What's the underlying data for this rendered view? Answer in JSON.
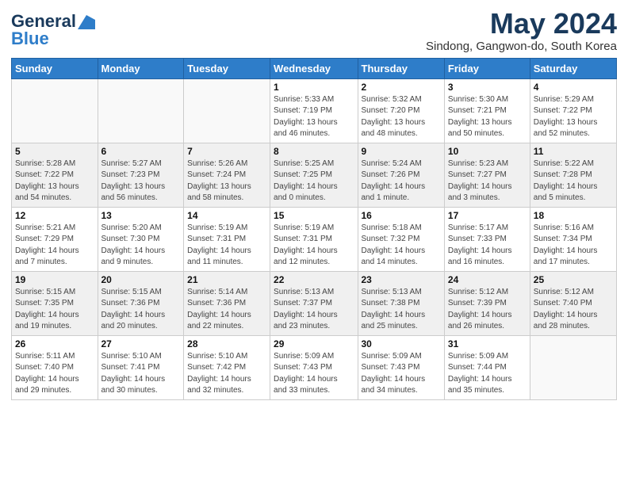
{
  "logo": {
    "line1": "General",
    "line2": "Blue",
    "tagline": ""
  },
  "title": "May 2024",
  "location": "Sindong, Gangwon-do, South Korea",
  "weekdays": [
    "Sunday",
    "Monday",
    "Tuesday",
    "Wednesday",
    "Thursday",
    "Friday",
    "Saturday"
  ],
  "weeks": [
    [
      {
        "day": "",
        "info": ""
      },
      {
        "day": "",
        "info": ""
      },
      {
        "day": "",
        "info": ""
      },
      {
        "day": "1",
        "info": "Sunrise: 5:33 AM\nSunset: 7:19 PM\nDaylight: 13 hours\nand 46 minutes."
      },
      {
        "day": "2",
        "info": "Sunrise: 5:32 AM\nSunset: 7:20 PM\nDaylight: 13 hours\nand 48 minutes."
      },
      {
        "day": "3",
        "info": "Sunrise: 5:30 AM\nSunset: 7:21 PM\nDaylight: 13 hours\nand 50 minutes."
      },
      {
        "day": "4",
        "info": "Sunrise: 5:29 AM\nSunset: 7:22 PM\nDaylight: 13 hours\nand 52 minutes."
      }
    ],
    [
      {
        "day": "5",
        "info": "Sunrise: 5:28 AM\nSunset: 7:22 PM\nDaylight: 13 hours\nand 54 minutes."
      },
      {
        "day": "6",
        "info": "Sunrise: 5:27 AM\nSunset: 7:23 PM\nDaylight: 13 hours\nand 56 minutes."
      },
      {
        "day": "7",
        "info": "Sunrise: 5:26 AM\nSunset: 7:24 PM\nDaylight: 13 hours\nand 58 minutes."
      },
      {
        "day": "8",
        "info": "Sunrise: 5:25 AM\nSunset: 7:25 PM\nDaylight: 14 hours\nand 0 minutes."
      },
      {
        "day": "9",
        "info": "Sunrise: 5:24 AM\nSunset: 7:26 PM\nDaylight: 14 hours\nand 1 minute."
      },
      {
        "day": "10",
        "info": "Sunrise: 5:23 AM\nSunset: 7:27 PM\nDaylight: 14 hours\nand 3 minutes."
      },
      {
        "day": "11",
        "info": "Sunrise: 5:22 AM\nSunset: 7:28 PM\nDaylight: 14 hours\nand 5 minutes."
      }
    ],
    [
      {
        "day": "12",
        "info": "Sunrise: 5:21 AM\nSunset: 7:29 PM\nDaylight: 14 hours\nand 7 minutes."
      },
      {
        "day": "13",
        "info": "Sunrise: 5:20 AM\nSunset: 7:30 PM\nDaylight: 14 hours\nand 9 minutes."
      },
      {
        "day": "14",
        "info": "Sunrise: 5:19 AM\nSunset: 7:31 PM\nDaylight: 14 hours\nand 11 minutes."
      },
      {
        "day": "15",
        "info": "Sunrise: 5:19 AM\nSunset: 7:31 PM\nDaylight: 14 hours\nand 12 minutes."
      },
      {
        "day": "16",
        "info": "Sunrise: 5:18 AM\nSunset: 7:32 PM\nDaylight: 14 hours\nand 14 minutes."
      },
      {
        "day": "17",
        "info": "Sunrise: 5:17 AM\nSunset: 7:33 PM\nDaylight: 14 hours\nand 16 minutes."
      },
      {
        "day": "18",
        "info": "Sunrise: 5:16 AM\nSunset: 7:34 PM\nDaylight: 14 hours\nand 17 minutes."
      }
    ],
    [
      {
        "day": "19",
        "info": "Sunrise: 5:15 AM\nSunset: 7:35 PM\nDaylight: 14 hours\nand 19 minutes."
      },
      {
        "day": "20",
        "info": "Sunrise: 5:15 AM\nSunset: 7:36 PM\nDaylight: 14 hours\nand 20 minutes."
      },
      {
        "day": "21",
        "info": "Sunrise: 5:14 AM\nSunset: 7:36 PM\nDaylight: 14 hours\nand 22 minutes."
      },
      {
        "day": "22",
        "info": "Sunrise: 5:13 AM\nSunset: 7:37 PM\nDaylight: 14 hours\nand 23 minutes."
      },
      {
        "day": "23",
        "info": "Sunrise: 5:13 AM\nSunset: 7:38 PM\nDaylight: 14 hours\nand 25 minutes."
      },
      {
        "day": "24",
        "info": "Sunrise: 5:12 AM\nSunset: 7:39 PM\nDaylight: 14 hours\nand 26 minutes."
      },
      {
        "day": "25",
        "info": "Sunrise: 5:12 AM\nSunset: 7:40 PM\nDaylight: 14 hours\nand 28 minutes."
      }
    ],
    [
      {
        "day": "26",
        "info": "Sunrise: 5:11 AM\nSunset: 7:40 PM\nDaylight: 14 hours\nand 29 minutes."
      },
      {
        "day": "27",
        "info": "Sunrise: 5:10 AM\nSunset: 7:41 PM\nDaylight: 14 hours\nand 30 minutes."
      },
      {
        "day": "28",
        "info": "Sunrise: 5:10 AM\nSunset: 7:42 PM\nDaylight: 14 hours\nand 32 minutes."
      },
      {
        "day": "29",
        "info": "Sunrise: 5:09 AM\nSunset: 7:43 PM\nDaylight: 14 hours\nand 33 minutes."
      },
      {
        "day": "30",
        "info": "Sunrise: 5:09 AM\nSunset: 7:43 PM\nDaylight: 14 hours\nand 34 minutes."
      },
      {
        "day": "31",
        "info": "Sunrise: 5:09 AM\nSunset: 7:44 PM\nDaylight: 14 hours\nand 35 minutes."
      },
      {
        "day": "",
        "info": ""
      }
    ]
  ]
}
